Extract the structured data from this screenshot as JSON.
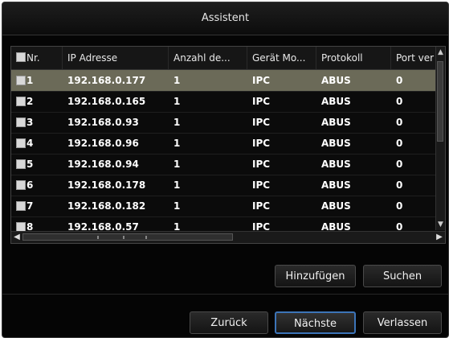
{
  "window": {
    "title": "Assistent"
  },
  "table": {
    "columns": [
      "Nr.",
      "IP Adresse",
      "Anzahl de...",
      "Gerät Mo...",
      "Protokoll",
      "Port ver"
    ],
    "rows": [
      {
        "nr": "1",
        "ip": "192.168.0.177",
        "count": "1",
        "model": "IPC",
        "protocol": "ABUS",
        "port": "0",
        "selected": true
      },
      {
        "nr": "2",
        "ip": "192.168.0.165",
        "count": "1",
        "model": "IPC",
        "protocol": "ABUS",
        "port": "0",
        "selected": false
      },
      {
        "nr": "3",
        "ip": "192.168.0.93",
        "count": "1",
        "model": "IPC",
        "protocol": "ABUS",
        "port": "0",
        "selected": false
      },
      {
        "nr": "4",
        "ip": "192.168.0.96",
        "count": "1",
        "model": "IPC",
        "protocol": "ABUS",
        "port": "0",
        "selected": false
      },
      {
        "nr": "5",
        "ip": "192.168.0.94",
        "count": "1",
        "model": "IPC",
        "protocol": "ABUS",
        "port": "0",
        "selected": false
      },
      {
        "nr": "6",
        "ip": "192.168.0.178",
        "count": "1",
        "model": "IPC",
        "protocol": "ABUS",
        "port": "0",
        "selected": false
      },
      {
        "nr": "7",
        "ip": "192.168.0.182",
        "count": "1",
        "model": "IPC",
        "protocol": "ABUS",
        "port": "0",
        "selected": false
      },
      {
        "nr": "8",
        "ip": "192.168.0.57",
        "count": "1",
        "model": "IPC",
        "protocol": "ABUS",
        "port": "0",
        "selected": false
      }
    ]
  },
  "actions": {
    "add_label": "Hinzufügen",
    "search_label": "Suchen"
  },
  "footer": {
    "back_label": "Zurück",
    "next_label": "Nächste",
    "exit_label": "Verlassen"
  },
  "icons": {
    "scroll_up": "chevron-up-icon",
    "scroll_down": "chevron-down-icon",
    "scroll_left": "chevron-left-icon",
    "scroll_right": "chevron-right-icon"
  },
  "colors": {
    "selected_row": "#6b6a58",
    "primary_border": "#3c74b8",
    "background": "#050505"
  }
}
